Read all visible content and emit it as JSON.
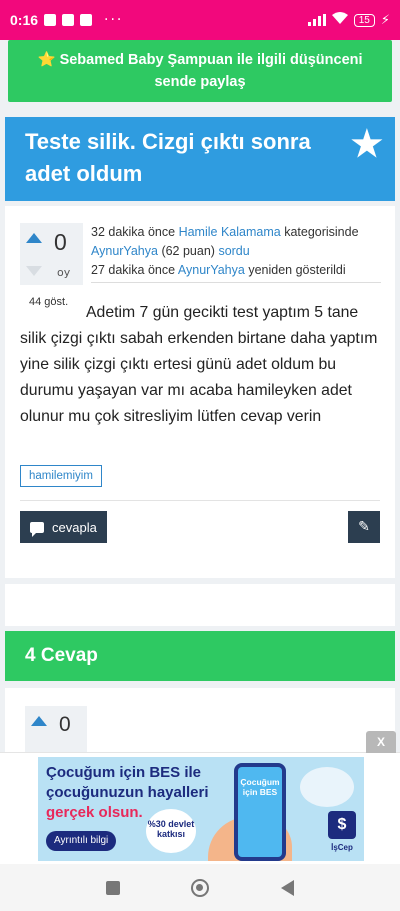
{
  "status_bar": {
    "time": "0:16",
    "battery": "15"
  },
  "share_banner": {
    "star": "⭐",
    "text": "Sebamed Baby Şampuan ile ilgili düşünceni sende paylaş"
  },
  "question": {
    "title": "Teste silik. Cizgi çıktı sonra adet oldum",
    "votes": "0",
    "votes_unit": "oy",
    "meta": {
      "asked_time": "32 dakika önce",
      "category": "Hamile Kalamama",
      "category_suffix": "kategorisinde",
      "author": "AynurYahya",
      "author_points": "(62 puan)",
      "asked_word": "sordu",
      "reshown_time": "27 dakika önce",
      "reshown_author": "AynurYahya",
      "reshown_word": "yeniden gösterildi"
    },
    "views": "44 göst.",
    "body": "Adetim 7 gün gecikti test yaptım 5 tane silik çizgi çıktı sabah erkenden birtane daha yaptım yine silik çizgi çıktı ertesi günü adet oldum  bu durumu yaşayan var mı  acaba hamileyken adet olunur mu çok sitresliyim lütfen cevap verin",
    "tag": "hamilemiyim",
    "reply_label": "cevapla"
  },
  "answers": {
    "header": "4 Cevap",
    "first_votes": "0"
  },
  "ad": {
    "close": "X",
    "line1": "Çocuğum için BES ile",
    "line2": "çocuğunuzun hayalleri",
    "line3": "gerçek olsun.",
    "button": "Ayrıntılı bilgi",
    "badge": "%30 devlet katkısı",
    "phone_text": "Çocuğum için BES",
    "logo_label": "İşCep"
  }
}
